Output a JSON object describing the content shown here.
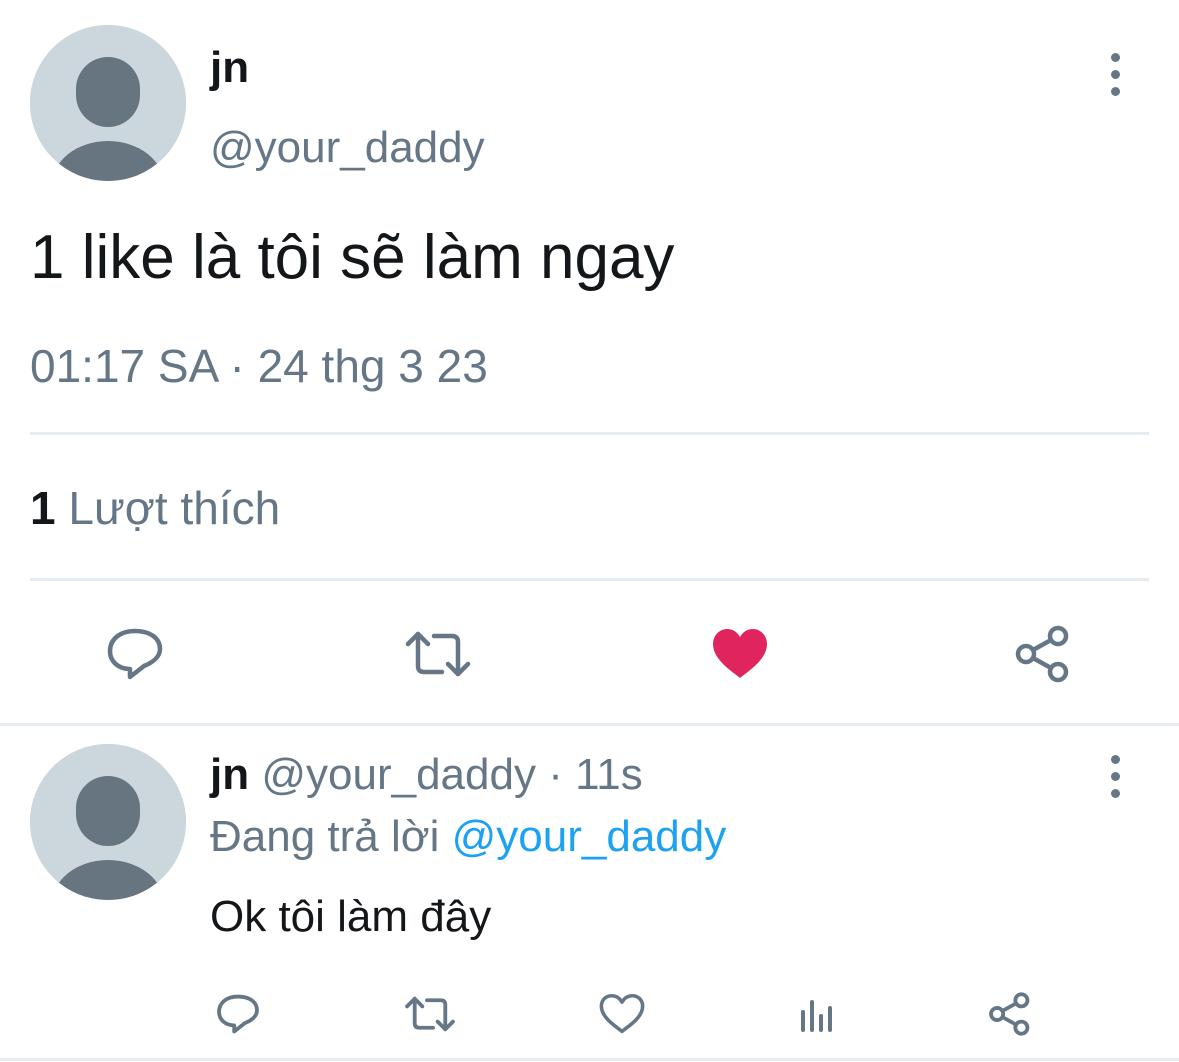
{
  "tweet": {
    "author_name": "jn",
    "author_handle": "@your_daddy",
    "text": "1 like là tôi sẽ làm ngay",
    "timestamp": "01:17 SA · 24 thg 3 23",
    "likes_count": "1",
    "likes_label": "Lượt thích",
    "liked": true,
    "like_color": "#e0245e"
  },
  "reply": {
    "author_name": "jn",
    "author_handle": "@your_daddy",
    "separator": " · ",
    "age": "11s",
    "replying_prefix": "Đang trả lời",
    "replying_to": "@your_daddy",
    "text": "Ok tôi làm đây"
  },
  "colors": {
    "accent": "#1da1f2",
    "secondary_text": "#657786",
    "primary_text": "#14171a",
    "divider": "#e6ecf0"
  },
  "icons": {
    "main_actions": [
      "reply-icon",
      "retweet-icon",
      "heart-filled-icon",
      "share-icon"
    ],
    "reply_actions": [
      "reply-icon",
      "retweet-icon",
      "heart-icon",
      "analytics-icon",
      "share-icon"
    ]
  }
}
